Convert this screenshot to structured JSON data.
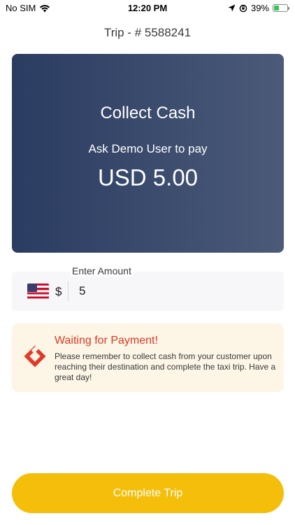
{
  "status_bar": {
    "carrier": "No SIM",
    "time": "12:20 PM",
    "battery": "39%",
    "battery_level": 0.39
  },
  "header": {
    "title": "Trip - # 5588241"
  },
  "card": {
    "title": "Collect Cash",
    "subtitle": "Ask Demo User to pay",
    "amount": "USD 5.00"
  },
  "amount_input": {
    "label": "Enter Amount",
    "currency_symbol": "$",
    "value": "5",
    "flag_icon": "us-flag-icon"
  },
  "notice": {
    "title": "Waiting for Payment!",
    "body": "Please remember to collect cash from your customer upon reaching their destination and complete the taxi trip. Have a great day!",
    "icon": "payment-wait-icon"
  },
  "actions": {
    "complete_label": "Complete Trip"
  },
  "colors": {
    "card_gradient_start": "#2b3c62",
    "card_gradient_end": "#4b5a78",
    "notice_bg": "#fdf6e6",
    "notice_title": "#d93a26",
    "button_bg": "#f4be0b"
  }
}
